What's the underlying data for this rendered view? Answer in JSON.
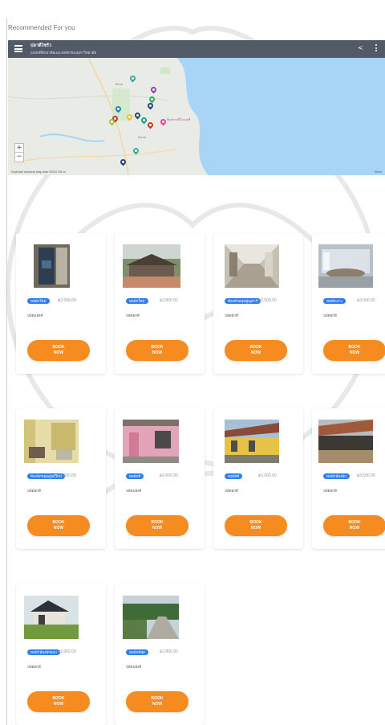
{
  "section": {
    "title": "Recommended For you"
  },
  "map": {
    "title": "ปลาดีไซร้ว",
    "subtitle": "แหล่งที่พักอาศัยและหอพักรอบมหาวิทยาลัย",
    "label_pink": "ชื่อสถานที่ในแผนที่",
    "label_1": "ตำบล",
    "label_2": "อำเภอ",
    "footer_left": "Keyboard shortcuts   Map data ©2020   200 m",
    "footer_right": "Terms",
    "zoom_in": "+",
    "zoom_out": "−",
    "colors": {
      "water": "#a8d4f5",
      "land": "#e8ebe6",
      "header": "#374150"
    }
  },
  "listings": [
    {
      "tag": "หอพักใหม่",
      "price": "฿2,500.00",
      "place": "ปลัดบลังค์",
      "button": "BOOK NOW"
    },
    {
      "tag": "หอพักใหม่",
      "price": "฿2,800.00",
      "place": "ปลัดยกดี",
      "button": "BOOK NOW"
    },
    {
      "tag": "ห้องพักหลุมศูญคาร์",
      "price": "฿2,500.00",
      "place": "ปลัดยกดี",
      "button": "BOOK NOW"
    },
    {
      "tag": "หอพักเงาะ",
      "price": "฿3,000.00",
      "place": "ปลัดยกดี",
      "button": "BOOK NOW"
    },
    {
      "tag": "ห้องพักหลุมศูนย์ใหม่",
      "price": "฿4,000.00",
      "place": "ปลัดยกดี",
      "button": "BOOK NOW"
    },
    {
      "tag": "หอพักดี",
      "price": "฿3,600.00",
      "place": "ปลัดบลังค์",
      "button": "BOOK NOW"
    },
    {
      "tag": "หอพักดี",
      "price": "฿3,500.00",
      "place": "ปลัดยกดี",
      "button": "BOOK NOW"
    },
    {
      "tag": "หอพักห้องพัก",
      "price": "฿3,500.00",
      "place": "ปลัดยกดี",
      "button": "BOOK NOW"
    },
    {
      "tag": "หอพักห้องพักสงบ",
      "price": "฿3,900.00",
      "place": "ปลัดยกดี",
      "button": "BOOK NOW"
    },
    {
      "tag": "หอพักดีสุด",
      "price": "฿2,800.00",
      "place": "ปลัดบลังค์",
      "button": "BOOK NOW"
    }
  ],
  "theme": {
    "button_color": "#f68b1f",
    "tag_color": "#2f7ef0"
  }
}
